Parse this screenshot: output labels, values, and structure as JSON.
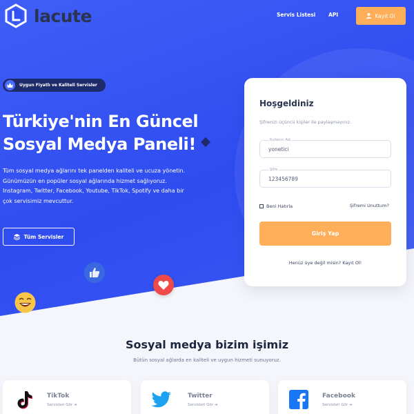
{
  "brand": {
    "name": "lacute"
  },
  "nav": {
    "links": [
      "Servis Listesi",
      "API"
    ],
    "register_label": "Kayıt Ol"
  },
  "hero": {
    "badge": "Uygun Fiyatlı ve Kaliteli Servisler",
    "headline_line1": "Türkiye'nin En Güncel",
    "headline_line2": "Sosyal Medya Paneli!",
    "description": "Tüm sosyal medya ağlarını tek panelden kaliteli ve ucuza yönetin. Günümüzün en popüler sosyal ağlarında hizmet sağlıyoruz. Instagram, Twitter, Facebook, Youtube, TikTok, Spotify ve daha bir çok servisimiz mevcuttur.",
    "all_services_label": "Tüm Servisler"
  },
  "login": {
    "title": "Hoşgeldiniz",
    "subtitle": "Şifrenizi üçüncü kişiler ile paylaşmayınız.",
    "username_label": "Kullanıcı Adı",
    "username_value": "yonetici",
    "password_label": "Şifre",
    "password_value": "123456789",
    "remember_label": "Beni Hatırla",
    "forgot_label": "Şifremi Unuttum?",
    "submit_label": "Giriş Yap",
    "signup_text": "Henüz üye değil misin? Kayıt Ol!"
  },
  "section": {
    "title": "Sosyal medya bizim işimiz",
    "subtitle": "Bütün sosyal ağlarda en kaliteli ve uygun hizmeti sunuyoruz.",
    "services": [
      {
        "name": "TikTok",
        "link": "Servisleri Gör",
        "icon": "tiktok-icon"
      },
      {
        "name": "Twitter",
        "link": "Servisleri Gör",
        "icon": "twitter-icon"
      },
      {
        "name": "Facebook",
        "link": "Servisleri Gör",
        "icon": "facebook-icon"
      }
    ]
  },
  "colors": {
    "primary_blue": "#3350f2",
    "accent_orange": "#ffae5a",
    "dark_navy": "#1e253e"
  }
}
